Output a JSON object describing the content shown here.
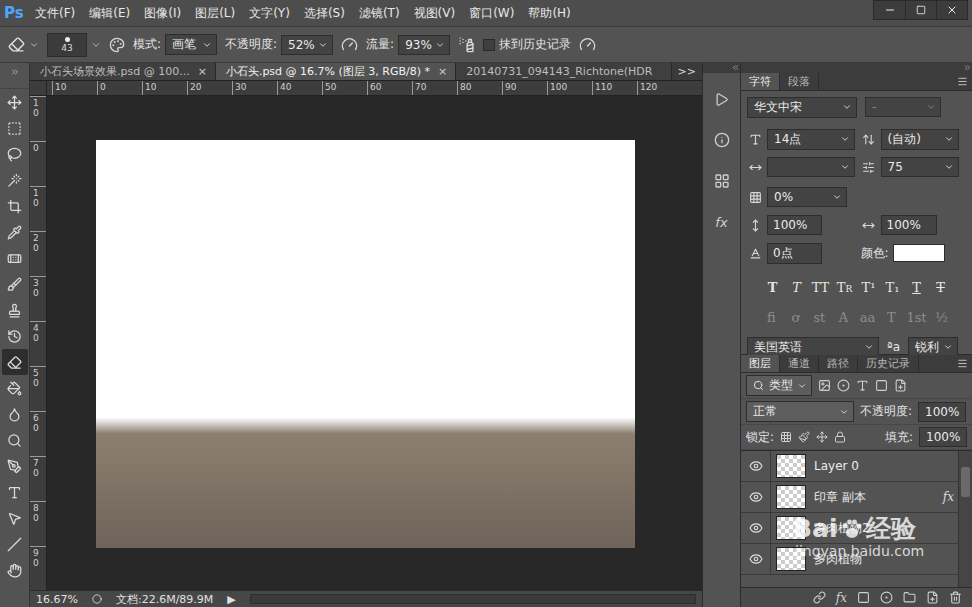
{
  "app": {
    "logo": "Ps"
  },
  "menu": [
    "文件(F)",
    "编辑(E)",
    "图像(I)",
    "图层(L)",
    "文字(Y)",
    "选择(S)",
    "滤镜(T)",
    "视图(V)",
    "窗口(W)",
    "帮助(H)"
  ],
  "options_bar": {
    "brush_size": "43",
    "mode_label": "模式:",
    "mode": "画笔",
    "opacity_label": "不透明度:",
    "opacity": "52%",
    "flow_label": "流量:",
    "flow": "93%",
    "history": {
      "label": "抹到历史记录",
      "checked": false
    }
  },
  "tools": [
    {
      "selected": false
    },
    {
      "selected": false
    },
    {
      "selected": false
    },
    {
      "selected": false
    },
    {
      "selected": false
    },
    {
      "selected": false
    },
    {
      "selected": false
    },
    {
      "selected": false
    },
    {
      "selected": false
    },
    {
      "selected": false
    },
    {
      "selected": true
    },
    {
      "selected": false
    },
    {
      "selected": false
    },
    {
      "selected": false
    },
    {
      "selected": false
    },
    {
      "selected": false
    },
    {
      "selected": false
    },
    {
      "selected": false
    },
    {
      "selected": false
    }
  ],
  "doc_tabs": [
    {
      "label": "小石头场景效果.psd @ 100...",
      "selected": false,
      "close": "×"
    },
    {
      "label": "小石头.psd @ 16.7% (图层 3, RGB/8) *",
      "selected": true,
      "close": "×"
    },
    {
      "label": "20140731_094143_Richtone(HDR",
      "selected": false,
      "close": ""
    }
  ],
  "tabs_overflow": ">>",
  "ruler": {
    "horizontal": [
      "10",
      "0",
      "10",
      "20",
      "30",
      "40",
      "50",
      "60",
      "70",
      "80",
      "90",
      "100",
      "110",
      "120"
    ],
    "vertical": [
      "10",
      "0",
      "10",
      "20",
      "30",
      "40",
      "50",
      "60",
      "70",
      "80",
      "90"
    ]
  },
  "status_bar": {
    "zoom": "16.67%",
    "doc": "文档:22.6M/89.9M",
    "arrow": "▶"
  },
  "dock": {
    "fx": "fx"
  },
  "character_panel": {
    "tabs": [
      {
        "label": "字符",
        "selected": true
      },
      {
        "label": "段落",
        "selected": false
      }
    ],
    "font_family": "华文中宋",
    "font_style": "-",
    "font_style_disabled": true,
    "size": "14点",
    "leading": "(自动)",
    "kerning": "",
    "tracking": "75",
    "tsume": "0%",
    "vertical_scale": "100%",
    "horizontal_scale": "100%",
    "baseline": "0点",
    "color_label": "颜色:",
    "color_swatch": "#ffffff",
    "styles": [
      {
        "text": "T",
        "kind": "bold"
      },
      {
        "text": "T",
        "kind": "italic"
      },
      {
        "text": "TT",
        "kind": "allcaps"
      },
      {
        "text": "Tr",
        "kind": "smallcaps"
      },
      {
        "text": "T¹",
        "kind": "superscript"
      },
      {
        "text": "T₁",
        "kind": "subscript"
      },
      {
        "text": "T",
        "kind": "underline"
      },
      {
        "text": "T",
        "kind": "strikethrough"
      }
    ],
    "opentype": {
      "items": [
        "fi",
        "ơ",
        "st",
        "A",
        "aa",
        "T",
        "1st",
        "½"
      ],
      "disabled": true
    },
    "language": "美国英语",
    "aa_icon": "ªa",
    "antialias": "锐利"
  },
  "layers_panel": {
    "tabs": [
      {
        "label": "图层",
        "selected": true
      },
      {
        "label": "通道",
        "selected": false
      },
      {
        "label": "路径",
        "selected": false
      },
      {
        "label": "历史记录",
        "selected": false
      }
    ],
    "filter": "类型",
    "blend_mode": "正常",
    "opacity_label": "不透明度:",
    "opacity": "100%",
    "lock_label": "锁定:",
    "fill_label": "填充:",
    "fill": "100%",
    "fx_label": "fx",
    "layers": [
      {
        "name": "Layer 0",
        "visible": true,
        "fx": false,
        "selected": false
      },
      {
        "name": "印章 副本",
        "visible": true,
        "fx": true,
        "selected": false
      },
      {
        "name": "多肉植物2",
        "visible": true,
        "fx": false,
        "selected": false
      },
      {
        "name": "多肉植物",
        "visible": true,
        "fx": false,
        "selected": false
      }
    ]
  },
  "watermark": {
    "brand": "Bai",
    "product": "经验",
    "url": "jingyan.baidu.com"
  }
}
